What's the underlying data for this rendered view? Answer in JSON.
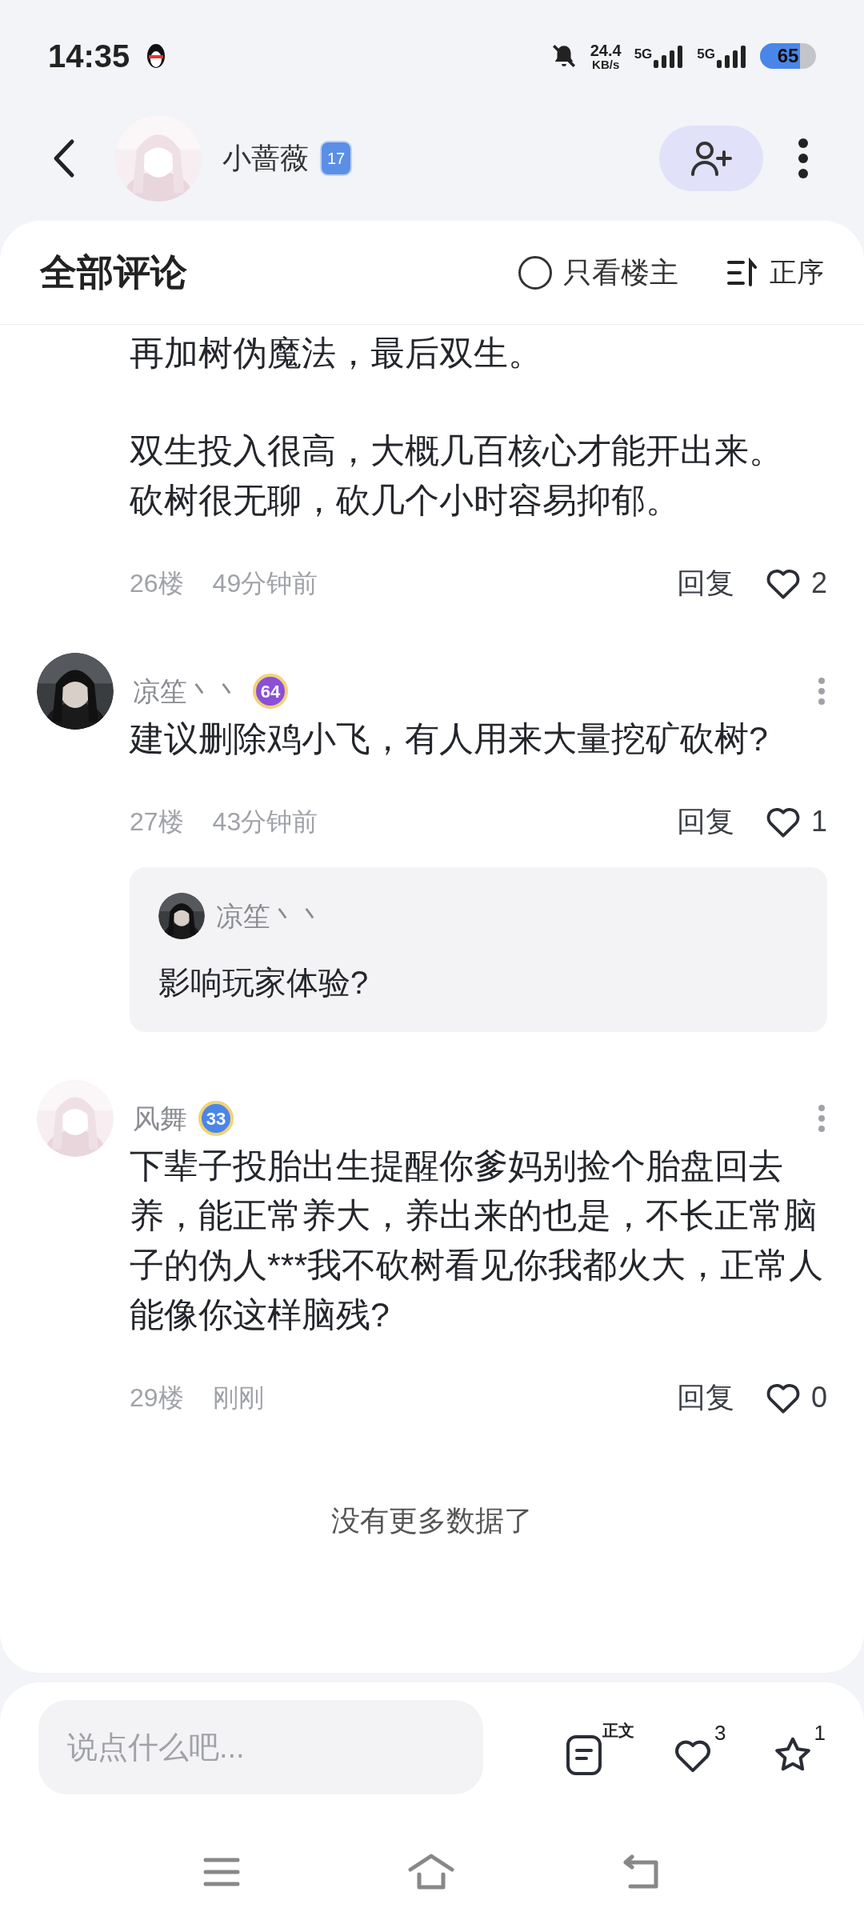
{
  "status_bar": {
    "time": "14:35",
    "net_speed": "24.4",
    "net_unit": "KB/s",
    "sim1": "5G",
    "sim2": "5G",
    "battery": "65"
  },
  "header": {
    "user_name": "小蔷薇",
    "level_badge": "17"
  },
  "comments_header": {
    "title": "全部评论",
    "filter": {
      "label": "只看楼主",
      "checked": false
    },
    "sort": "正序"
  },
  "comments": [
    {
      "kind": "continuation",
      "paragraphs": [
        "再加树伪魔法，最后双生。",
        "双生投入很高，大概几百核心才能开出来。",
        "砍树很无聊，砍几个小时容易抑郁。"
      ],
      "floor": "26楼",
      "time": "49分钟前",
      "reply": "回复",
      "liked": false,
      "likes": "2"
    },
    {
      "kind": "full",
      "author": "凉笙丶丶",
      "badge": {
        "text": "64",
        "color": "#8b4fd8"
      },
      "paragraphs": [
        "建议删除鸡小飞，有人用来大量挖矿砍树?"
      ],
      "floor": "27楼",
      "time": "43分钟前",
      "reply": "回复",
      "liked": false,
      "likes": "1",
      "replies": [
        {
          "author": "凉笙丶丶",
          "text": "影响玩家体验?"
        }
      ]
    },
    {
      "kind": "full",
      "author": "风舞",
      "badge": {
        "text": "33",
        "color": "#4a86e8"
      },
      "paragraphs": [
        "下辈子投胎出生提醒你爹妈别捡个胎盘回去养，能正常养大，养出来的也是，不长正常脑子的伪人***我不砍树看见你我都火大，正常人能像你这样脑残?"
      ],
      "floor": "29楼",
      "time": "刚刚",
      "reply": "回复",
      "liked": false,
      "likes": "0"
    }
  ],
  "end_note": "没有更多数据了",
  "bottom_bar": {
    "placeholder": "说点什么吧...",
    "doc_label": "正文",
    "likes": "3",
    "liked": false,
    "stars": "1",
    "starred": false
  }
}
